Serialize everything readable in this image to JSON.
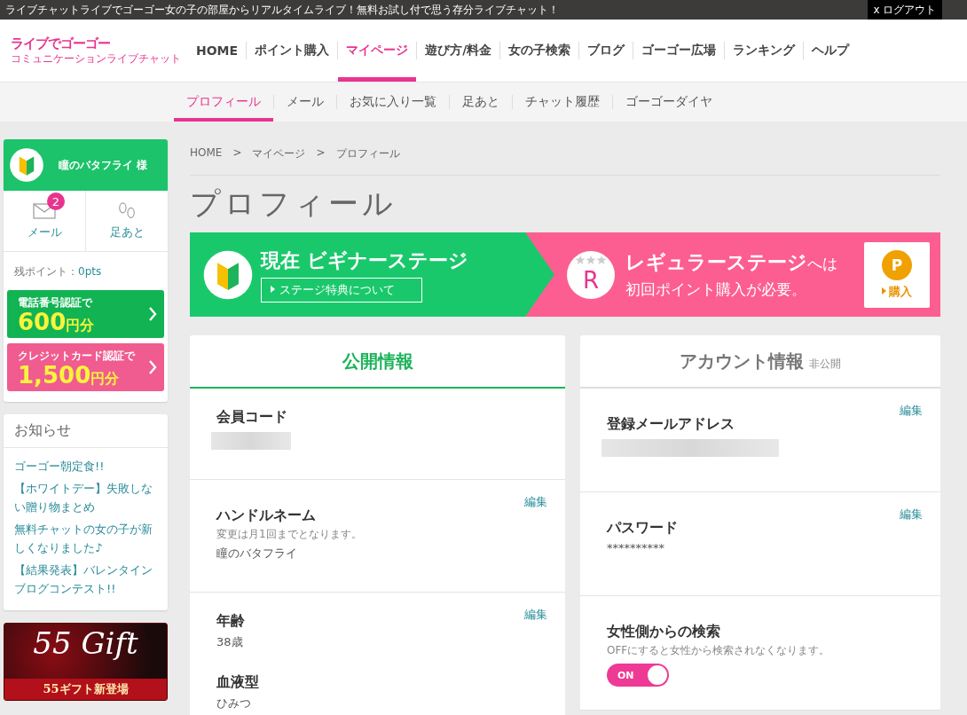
{
  "top_bar": {
    "tagline": "ライブチャットライブでゴーゴー女の子の部屋からリアルタイムライブ！無料お試し付で思う存分ライブチャット！",
    "logout": "x ログアウト"
  },
  "logo": {
    "title": "ライブでゴーゴー",
    "subtitle": "コミュニケーションライブチャット"
  },
  "nav": [
    {
      "label": "HOME",
      "selected": false
    },
    {
      "label": "ポイント購入",
      "selected": false
    },
    {
      "label": "マイページ",
      "selected": true
    },
    {
      "label": "遊び方/料金",
      "selected": false
    },
    {
      "label": "女の子検索",
      "selected": false
    },
    {
      "label": "ブログ",
      "selected": false
    },
    {
      "label": "ゴーゴー広場",
      "selected": false
    },
    {
      "label": "ランキング",
      "selected": false
    },
    {
      "label": "ヘルプ",
      "selected": false
    }
  ],
  "subnav": [
    {
      "label": "プロフィール",
      "selected": true
    },
    {
      "label": "メール",
      "selected": false
    },
    {
      "label": "お気に入り一覧",
      "selected": false
    },
    {
      "label": "足あと",
      "selected": false
    },
    {
      "label": "チャット履歴",
      "selected": false
    },
    {
      "label": "ゴーゴーダイヤ",
      "selected": false
    }
  ],
  "user": {
    "name": "瞳のバタフライ 様",
    "links": [
      {
        "kind": "mail",
        "label": "メール",
        "badge": "2"
      },
      {
        "kind": "footprints",
        "label": "足あと"
      }
    ],
    "points_label": "残ポイント：",
    "points": "0pts"
  },
  "promos": [
    {
      "kind": "green",
      "caption": "電話番号認証で",
      "amount": "600",
      "unit": "円分"
    },
    {
      "kind": "pink",
      "caption": "クレジットカード認証で",
      "amount": "1,500",
      "unit": "円分"
    }
  ],
  "news": {
    "title": "お知らせ",
    "items": [
      "ゴーゴー朝定食!!",
      "【ホワイトデー】失敗しない贈り物まとめ",
      "無料チャットの女の子が新しくなりました♪",
      "【結果発表】バレンタインブログコンテスト!!"
    ]
  },
  "gift_banner": {
    "title": "55 Gift",
    "caption": "55ギフト新登場"
  },
  "breadcrumb": {
    "separator": ">",
    "items": [
      "HOME",
      "マイページ",
      "プロフィール"
    ]
  },
  "page_title": "プロフィール",
  "stage_banner": {
    "current_label": "現在",
    "current_stage": "ビギナーステージ",
    "benefits_button": "ステージ特典について",
    "badge_letter": "R",
    "next_stage": "レギュラーステージ",
    "next_suffix": "へは",
    "next_requirement": "初回ポイント購入が必要。",
    "buy_icon": "P",
    "buy_button": "購入"
  },
  "panels": [
    {
      "title": "公開情報",
      "selected": true,
      "sections": [
        {
          "fields": [
            {
              "label": "会員コード",
              "redacted": true
            }
          ]
        },
        {
          "edit": "編集",
          "fields": [
            {
              "label": "ハンドルネーム",
              "note": "変更は月1回までとなります。",
              "value": "瞳のバタフライ"
            }
          ]
        },
        {
          "edit": "編集",
          "fields": [
            {
              "label": "年齢",
              "value": "38歳"
            },
            {
              "label": "血液型",
              "value": "ひみつ"
            }
          ]
        }
      ]
    },
    {
      "title": "アカウント情報",
      "tag": "非公開",
      "selected": false,
      "sections": [
        {
          "edit": "編集",
          "fields": [
            {
              "label": "登録メールアドレス",
              "redacted": true
            }
          ]
        },
        {
          "edit": "編集",
          "fields": [
            {
              "label": "パスワード",
              "value": "**********"
            }
          ]
        },
        {
          "fields": [
            {
              "label": "女性側からの検索",
              "note": "OFFにすると女性から検索されなくなります。",
              "toggle": {
                "on": true,
                "label": "ON"
              }
            }
          ]
        }
      ]
    }
  ]
}
